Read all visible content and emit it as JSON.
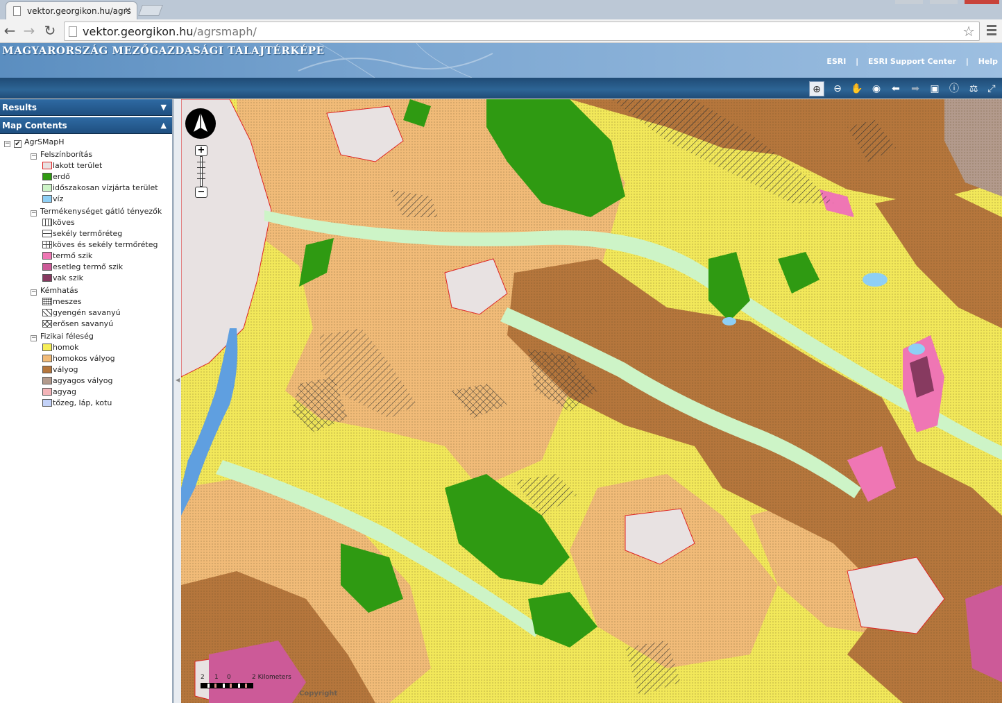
{
  "browser": {
    "tab_title": "vektor.georgikon.hu/agrs",
    "url": "vektor.georgikon.hu/agrsmaph/",
    "url_host": "vektor.georgikon.hu",
    "url_path": "/agrsmaph/"
  },
  "header": {
    "title": "MAGYARORSZÁG MEZŐGAZDASÁGI TALAJTÉRKÉPE",
    "links": [
      "ESRI",
      "ESRI Support Center",
      "Help"
    ],
    "separator": "|"
  },
  "toolbar": {
    "tools": [
      "zoom-in-icon",
      "zoom-out-icon",
      "pan-icon",
      "full-extent-icon",
      "back-icon",
      "forward-icon",
      "select-icon",
      "identify-icon",
      "measure-icon",
      "overview-icon"
    ]
  },
  "panels": {
    "results": "Results",
    "map_contents": "Map Contents"
  },
  "layers": {
    "root": "AgrSMapH",
    "groups": [
      {
        "name": "Felszínborítás",
        "items": [
          {
            "label": "lakott terület",
            "color": "#e8e2e2",
            "border": "#d22"
          },
          {
            "label": "erdő",
            "color": "#2f9a12"
          },
          {
            "label": "időszakosan vízjárta terület",
            "color": "#cdf4c7"
          },
          {
            "label": "víz",
            "color": "#8ecff5"
          }
        ]
      },
      {
        "name": "Termékenységet gátló tényezők",
        "items": [
          {
            "label": "köves",
            "pattern": "p-koves"
          },
          {
            "label": "sekély termőréteg",
            "pattern": "p-sekely"
          },
          {
            "label": "köves és sekély termőréteg",
            "pattern": "p-ks"
          },
          {
            "label": "termő szik",
            "color": "#ef76b4"
          },
          {
            "label": "esetleg termő szik",
            "color": "#cc5a98"
          },
          {
            "label": "vak szik",
            "color": "#873a60"
          }
        ]
      },
      {
        "name": "Kémhatás",
        "items": [
          {
            "label": "meszes",
            "pattern": "p-mesz"
          },
          {
            "label": "gyengén savanyú",
            "pattern": "p-gy"
          },
          {
            "label": "erősen savanyú",
            "pattern": "p-er"
          }
        ]
      },
      {
        "name": "Fizikai féleség",
        "items": [
          {
            "label": "homok",
            "color": "#f6ee58"
          },
          {
            "label": "homokos vályog",
            "color": "#f1bb78"
          },
          {
            "label": "vályog",
            "color": "#b5763c"
          },
          {
            "label": "agyagos vályog",
            "color": "#b39a8c"
          },
          {
            "label": "agyag",
            "color": "#f3b4b8"
          },
          {
            "label": "tőzeg, láp, kotu",
            "color": "#c3d2f8"
          }
        ]
      }
    ]
  },
  "map": {
    "scale_labels": [
      "2",
      "1",
      "0",
      "2 Kilometers"
    ],
    "copyright": "Copyright"
  }
}
